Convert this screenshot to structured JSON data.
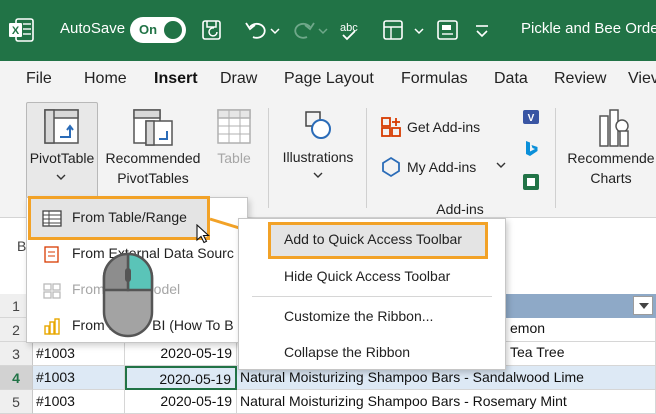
{
  "titlebar": {
    "autosave_label": "AutoSave",
    "autosave_state": "On",
    "doc_title": "Pickle and Bee Orde"
  },
  "menu": {
    "tabs": [
      "File",
      "Home",
      "Insert",
      "Draw",
      "Page Layout",
      "Formulas",
      "Data",
      "Review",
      "Viev"
    ],
    "active": "Insert"
  },
  "ribbon": {
    "pivot_label": "PivotTable",
    "recommended_pivot_line1": "Recommended",
    "recommended_pivot_line2": "PivotTables",
    "table_label": "Table",
    "illustrations_label": "Illustrations",
    "get_addins": "Get Add-ins",
    "my_addins": "My Add-ins",
    "addins_group": "Add-ins",
    "recommended_charts_line1": "Recommende",
    "recommended_charts_line2": "Charts"
  },
  "pivot_menu": {
    "items": [
      {
        "label": "From Table/Range",
        "enabled": true
      },
      {
        "label": "From External Data Sourc",
        "enabled": true
      },
      {
        "label": "From Data Model",
        "enabled": false
      },
      {
        "label": "From Power BI (How To B",
        "enabled": true
      }
    ]
  },
  "context_menu": {
    "items": [
      "Add to Quick Access Toolbar",
      "Hide Quick Access Toolbar",
      "Customize the Ribbon...",
      "Collapse the Ribbon"
    ]
  },
  "sheet": {
    "namebox_fragment": "B",
    "row_numbers": [
      "1",
      "2",
      "3",
      "4",
      "5"
    ],
    "selected_row": "4",
    "col_c_fragments": [
      "emon",
      "Tea Tree"
    ],
    "rows": [
      {
        "order": "#1003",
        "date": "2020-05-19",
        "product": "Natural Moisturizing Shampoo Bars - Sandalwood Lime"
      },
      {
        "order": "#1003",
        "date": "2020-05-19",
        "product": "Natural Moisturizing Shampoo Bars - Rosemary Mint"
      }
    ],
    "row3": {
      "order": "#1003",
      "date": "2020-05-19"
    }
  },
  "colors": {
    "excel_green": "#217346",
    "highlight_orange": "#f2a227"
  }
}
